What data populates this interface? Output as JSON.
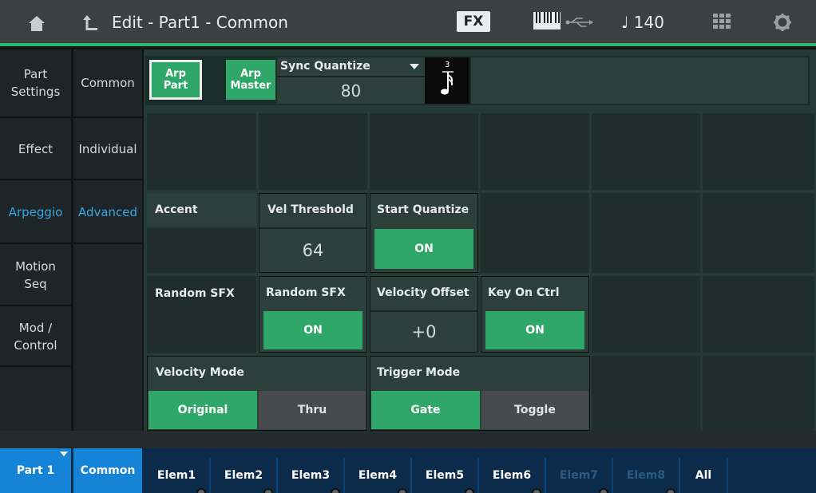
{
  "header": {
    "title": "Edit - Part1 - Common",
    "fx_label": "FX",
    "tempo": "♩ 140"
  },
  "left_nav": {
    "col1": [
      {
        "label": "Part\nSettings",
        "active": false
      },
      {
        "label": "Effect",
        "active": false
      },
      {
        "label": "Arpeggio",
        "active": true
      },
      {
        "label": "Motion\nSeq",
        "active": false
      },
      {
        "label": "Mod /\nControl",
        "active": false
      }
    ],
    "col2": [
      {
        "label": "Common",
        "active": false
      },
      {
        "label": "Individual",
        "active": false
      },
      {
        "label": "Advanced",
        "active": true
      }
    ]
  },
  "arp": {
    "part_label": "Arp\nPart",
    "master_label": "Arp\nMaster",
    "sync_quantize_label": "Sync Quantize",
    "sync_quantize_value": "80",
    "note_value_label": "3"
  },
  "accent": {
    "label": "Accent",
    "vel_threshold_label": "Vel Threshold",
    "vel_threshold_value": "64",
    "start_quantize_label": "Start Quantize",
    "start_quantize_value": "ON"
  },
  "random_sfx": {
    "label": "Random SFX",
    "switch_label": "Random SFX",
    "switch_value": "ON",
    "velocity_offset_label": "Velocity Offset",
    "velocity_offset_value": "+0",
    "key_on_ctrl_label": "Key On Ctrl",
    "key_on_ctrl_value": "ON"
  },
  "velocity_mode": {
    "label": "Velocity Mode",
    "options": [
      "Original",
      "Thru"
    ],
    "selected": "Original"
  },
  "trigger_mode": {
    "label": "Trigger Mode",
    "options": [
      "Gate",
      "Toggle"
    ],
    "selected": "Gate"
  },
  "bottom": {
    "part": "Part 1",
    "common": "Common",
    "elements": [
      "Elem1",
      "Elem2",
      "Elem3",
      "Elem4",
      "Elem5",
      "Elem6",
      "Elem7",
      "Elem8",
      "All"
    ]
  }
}
